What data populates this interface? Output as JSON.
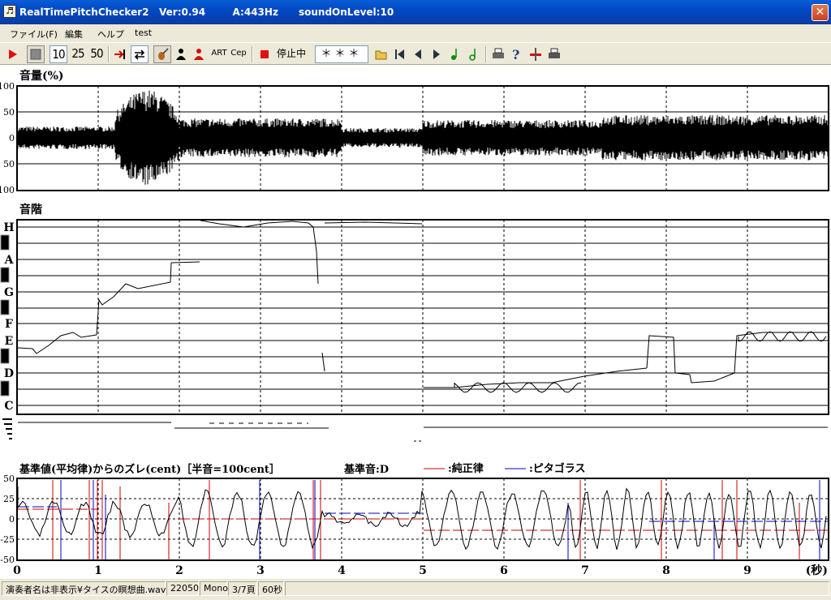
{
  "window": {
    "title": "RealTimePitchChecker2   Ver:0.94        A:443Hz      soundOnLevel:10",
    "close_glyph": "✕"
  },
  "menu": [
    "ファイル(F)",
    "編集",
    "ヘルプ",
    "test"
  ],
  "toolbar": {
    "btn_10": "10",
    "btn_25": "25",
    "btn_50": "50",
    "art": "ART",
    "cep": "Cep",
    "status": "停止中",
    "note_display": "＊＊＊"
  },
  "volume_panel": {
    "label": "音量(%)",
    "y_ticks": [
      "100",
      "50",
      "0",
      "50",
      "100"
    ]
  },
  "scale_panel": {
    "label": "音階",
    "notes": [
      "H",
      "A",
      "G",
      "F",
      "E",
      "D",
      "C"
    ]
  },
  "deviation_panel": {
    "label": "基準値(平均律)からのズレ(cent)［半音=100cent］",
    "base_note": "基準音:D",
    "legend_just": ":純正律",
    "legend_pyth": ":ピタゴラス",
    "y_ticks": [
      "50",
      "25",
      "0",
      "-25",
      "-50"
    ],
    "color_just": "#cc0000",
    "color_pyth": "#0000cc"
  },
  "time_axis": {
    "ticks": [
      "0",
      "1",
      "2",
      "3",
      "4",
      "5",
      "6",
      "7",
      "8",
      "9"
    ],
    "unit": "(秒)"
  },
  "statusbar": {
    "file": "演奏者名は非表示¥タイスの瞑想曲.wav",
    "rate": "22050",
    "channel": "Mono",
    "page": "3/7頁",
    "duration": "60秒"
  }
}
